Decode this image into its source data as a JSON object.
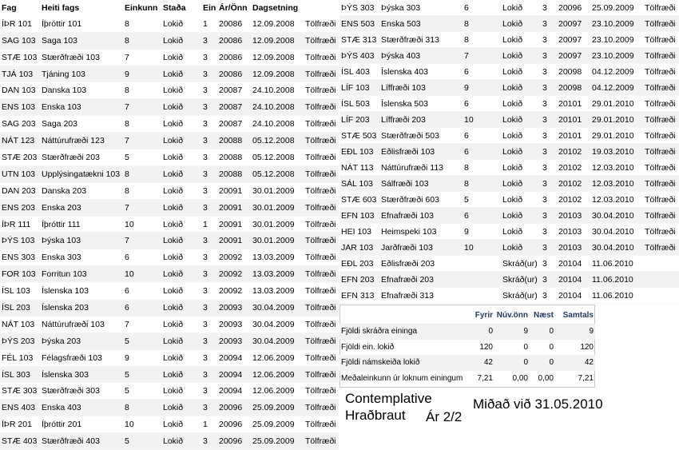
{
  "headers": {
    "fag": "Fag",
    "heiti": "Heiti fags",
    "einkunn": "Einkunn",
    "stada": "Staða",
    "ein": "Ein",
    "arOnn": "Ár/Önn",
    "dags": "Dagsetning"
  },
  "left_rows": [
    [
      "ÍÞR 101",
      "Íþróttir 101",
      "8",
      "Lokið",
      "1",
      "20086",
      "12.09.2008",
      "Tölfræði"
    ],
    [
      "SAG 103",
      "Saga 103",
      "8",
      "Lokið",
      "3",
      "20086",
      "12.09.2008",
      "Tölfræði"
    ],
    [
      "STÆ 103",
      "Stærðfræði 103",
      "7",
      "Lokið",
      "3",
      "20086",
      "12.09.2008",
      "Tölfræði"
    ],
    [
      "TJÁ 103",
      "Tjáning 103",
      "9",
      "Lokið",
      "3",
      "20086",
      "12.09.2008",
      "Tölfræði"
    ],
    [
      "DAN 103",
      "Danska 103",
      "8",
      "Lokið",
      "3",
      "20087",
      "24.10.2008",
      "Tölfræði"
    ],
    [
      "ENS 103",
      "Enska 103",
      "7",
      "Lokið",
      "3",
      "20087",
      "24.10.2008",
      "Tölfræði"
    ],
    [
      "SAG 203",
      "Saga 203",
      "8",
      "Lokið",
      "3",
      "20087",
      "24.10.2008",
      "Tölfræði"
    ],
    [
      "NÁT 123",
      "Náttúrufræði 123",
      "7",
      "Lokið",
      "3",
      "20088",
      "05.12.2008",
      "Tölfræði"
    ],
    [
      "STÆ 203",
      "Stærðfræði 203",
      "5",
      "Lokið",
      "3",
      "20088",
      "05.12.2008",
      "Tölfræði"
    ],
    [
      "UTN 103",
      "Upplýsingatækni 103",
      "8",
      "Lokið",
      "3",
      "20088",
      "05.12.2008",
      "Tölfræði"
    ],
    [
      "DAN 203",
      "Danska 203",
      "8",
      "Lokið",
      "3",
      "20091",
      "30.01.2009",
      "Tölfræði"
    ],
    [
      "ENS 203",
      "Enska 203",
      "7",
      "Lokið",
      "3",
      "20091",
      "30.01.2009",
      "Tölfræði"
    ],
    [
      "ÍÞR 111",
      "Íþróttir 111",
      "10",
      "Lokið",
      "1",
      "20091",
      "30.01.2009",
      "Tölfræði"
    ],
    [
      "ÞÝS 103",
      "Þýska 103",
      "7",
      "Lokið",
      "3",
      "20091",
      "30.01.2009",
      "Tölfræði"
    ],
    [
      "ENS 303",
      "Enska 303",
      "6",
      "Lokið",
      "3",
      "20092",
      "13.03.2009",
      "Tölfræði"
    ],
    [
      "FOR 103",
      "Forritun 103",
      "10",
      "Lokið",
      "3",
      "20092",
      "13.03.2009",
      "Tölfræði"
    ],
    [
      "ÍSL 103",
      "Íslenska 103",
      "6",
      "Lokið",
      "3",
      "20092",
      "13.03.2009",
      "Tölfræði"
    ],
    [
      "ÍSL 203",
      "Íslenska 203",
      "6",
      "Lokið",
      "3",
      "20093",
      "30.04.2009",
      "Tölfræði"
    ],
    [
      "NÁT 103",
      "Náttúrufræði 103",
      "7",
      "Lokið",
      "3",
      "20093",
      "30.04.2009",
      "Tölfræði"
    ],
    [
      "ÞÝS 203",
      "Þýska 203",
      "5",
      "Lokið",
      "3",
      "20093",
      "30.04.2009",
      "Tölfræði"
    ],
    [
      "FÉL 103",
      "Félagsfræði 103",
      "9",
      "Lokið",
      "3",
      "20094",
      "12.06.2009",
      "Tölfræði"
    ],
    [
      "ÍSL 303",
      "Íslenska 303",
      "5",
      "Lokið",
      "3",
      "20094",
      "12.06.2009",
      "Tölfræði"
    ],
    [
      "STÆ 303",
      "Stærðfræði 303",
      "5",
      "Lokið",
      "3",
      "20094",
      "12.06.2009",
      "Tölfræði"
    ],
    [
      "ENS 403",
      "Enska 403",
      "8",
      "Lokið",
      "3",
      "20096",
      "25.09.2009",
      "Tölfræði"
    ],
    [
      "ÍÞR 201",
      "Íþróttir 201",
      "10",
      "Lokið",
      "1",
      "20096",
      "25.09.2009",
      "Tölfræði"
    ],
    [
      "STÆ 403",
      "Stærðfræði 403",
      "5",
      "Lokið",
      "3",
      "20096",
      "25.09.2009",
      "Tölfræði"
    ]
  ],
  "right_rows": [
    [
      "ÞÝS 303",
      "Þýska 303",
      "6",
      "Lokið",
      "3",
      "20096",
      "25.09.2009",
      "Tölfræði"
    ],
    [
      "ENS 503",
      "Enska 503",
      "8",
      "Lokið",
      "3",
      "20097",
      "23.10.2009",
      "Tölfræði"
    ],
    [
      "STÆ 313",
      "Stærðfræði 313",
      "8",
      "Lokið",
      "3",
      "20097",
      "23.10.2009",
      "Tölfræði"
    ],
    [
      "ÞÝS 403",
      "Þýska 403",
      "7",
      "Lokið",
      "3",
      "20097",
      "23.10.2009",
      "Tölfræði"
    ],
    [
      "ÍSL 403",
      "Íslenska 403",
      "6",
      "Lokið",
      "3",
      "20098",
      "04.12.2009",
      "Tölfræði"
    ],
    [
      "LÍF 103",
      "Líffræði 103",
      "9",
      "Lokið",
      "3",
      "20098",
      "04.12.2009",
      "Tölfræði"
    ],
    [
      "ÍSL 503",
      "Íslenska 503",
      "6",
      "Lokið",
      "3",
      "20101",
      "29.01.2010",
      "Tölfræði"
    ],
    [
      "LÍF 203",
      "Líffræði 203",
      "10",
      "Lokið",
      "3",
      "20101",
      "29.01.2010",
      "Tölfræði"
    ],
    [
      "STÆ 503",
      "Stærðfræði 503",
      "6",
      "Lokið",
      "3",
      "20101",
      "29.01.2010",
      "Tölfræði"
    ],
    [
      "EÐL 103",
      "Eðlisfræði 103",
      "6",
      "Lokið",
      "3",
      "20102",
      "19.03.2010",
      "Tölfræði"
    ],
    [
      "NÁT 113",
      "Náttúrufræði 113",
      "8",
      "Lokið",
      "3",
      "20102",
      "12.03.2010",
      "Tölfræði"
    ],
    [
      "SÁL 103",
      "Sálfræði 103",
      "8",
      "Lokið",
      "3",
      "20102",
      "12.03.2010",
      "Tölfræði"
    ],
    [
      "STÆ 603",
      "Stærðfræði 603",
      "5",
      "Lokið",
      "3",
      "20102",
      "12.03.2010",
      "Tölfræði"
    ],
    [
      "EFN 103",
      "Efnafræði 103",
      "6",
      "Lokið",
      "3",
      "20103",
      "30.04.2010",
      "Tölfræði"
    ],
    [
      "HEI 103",
      "Heimspeki 103",
      "9",
      "Lokið",
      "3",
      "20103",
      "30.04.2010",
      "Tölfræði"
    ],
    [
      "JAR 103",
      "Jarðfræði 103",
      "10",
      "Lokið",
      "3",
      "20103",
      "30.04.2010",
      "Tölfræði"
    ],
    [
      "EÐL 203",
      "Eðlisfræði 203",
      "",
      "Skráð(ur)",
      "3",
      "20104",
      "11.06.2010",
      ""
    ],
    [
      "EFN 203",
      "Efnafræði 203",
      "",
      "Skráð(ur)",
      "3",
      "20104",
      "11.06.2010",
      ""
    ],
    [
      "EFN 313",
      "Efnafræði 313",
      "",
      "Skráð(ur)",
      "3",
      "20104",
      "11.06.2010",
      ""
    ]
  ],
  "summary": {
    "headers": [
      "Fyrir",
      "Núv.önn",
      "Næst",
      "Samtals"
    ],
    "rows": [
      [
        "Fjöldi skráðra eininga",
        "0",
        "9",
        "0",
        "9"
      ],
      [
        "Fjöldi ein. lokið",
        "120",
        "0",
        "0",
        "120"
      ],
      [
        "Fjöldi námskeiða lokið",
        "42",
        "0",
        "0",
        "42"
      ],
      [
        "Meðaleinkunn úr loknum einingum",
        "7,21",
        "0,00",
        "0,00",
        "7,21"
      ]
    ]
  },
  "footer": {
    "line1": "Contemplative",
    "line2": "Hraðbraut",
    "year": "Ár 2/2",
    "date_note": "Miðað við 31.05.2010"
  }
}
